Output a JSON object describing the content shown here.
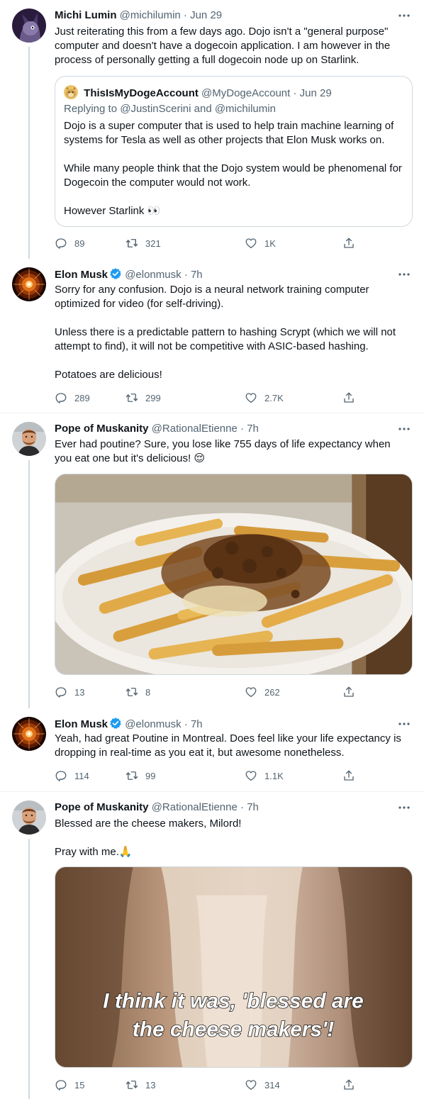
{
  "tweets": [
    {
      "name": "Michi Lumin",
      "handle": "@michilumin",
      "time": "Jun 29",
      "verified": false,
      "paragraphs": [
        "Just reiterating this from a few days ago.  Dojo isn't a \"general purpose\" computer and doesn't have a dogecoin application.  I am however in the process of personally getting a full dogecoin node up on Starlink."
      ],
      "quote": {
        "name": "ThisIsMyDogeAccount",
        "handle": "@MyDogeAccount",
        "time": "Jun 29",
        "replying": "Replying to @JustinScerini and @michilumin",
        "paragraphs": [
          "Dojo is a super computer that is used to help train machine learning of systems for Tesla as well as other projects that Elon Musk works on.",
          "While many people think that the Dojo system would be phenomenal for Dogecoin the computer would not work.",
          "However Starlink 👀"
        ]
      },
      "replies": "89",
      "retweets": "321",
      "likes": "1K"
    },
    {
      "name": "Elon Musk",
      "handle": "@elonmusk",
      "time": "7h",
      "verified": true,
      "paragraphs": [
        "Sorry for any confusion. Dojo is a neural network training computer optimized for video (for self-driving).",
        "Unless there is a predictable pattern to hashing Scrypt (which we will not attempt to find), it will not be competitive with ASIC-based hashing.",
        "Potatoes are delicious!"
      ],
      "replies": "289",
      "retweets": "299",
      "likes": "2.7K"
    },
    {
      "name": "Pope of Muskanity",
      "handle": "@RationalEtienne",
      "time": "7h",
      "verified": false,
      "paragraphs": [
        "Ever had poutine? Sure, you lose like 755 days of life expectancy when you eat one but it's delicious! 😌"
      ],
      "replies": "13",
      "retweets": "8",
      "likes": "262"
    },
    {
      "name": "Elon Musk",
      "handle": "@elonmusk",
      "time": "7h",
      "verified": true,
      "paragraphs": [
        "Yeah, had great Poutine in Montreal. Does feel like your life expectancy is dropping in real-time as you eat it, but awesome nonetheless."
      ],
      "replies": "114",
      "retweets": "99",
      "likes": "1.1K"
    },
    {
      "name": "Pope of Muskanity",
      "handle": "@RationalEtienne",
      "time": "7h",
      "verified": false,
      "paragraphs": [
        "Blessed are the cheese makers, Milord!",
        "Pray with me.🙏"
      ],
      "media_caption_line1": "I think it was, 'blessed are",
      "media_caption_line2": "the cheese makers'!",
      "replies": "15",
      "retweets": "13",
      "likes": "314"
    }
  ],
  "separator": "·",
  "colors": {
    "text": "#0f1419",
    "secondary": "#536471",
    "border": "#cfd9de",
    "verified": "#1d9bf0"
  }
}
